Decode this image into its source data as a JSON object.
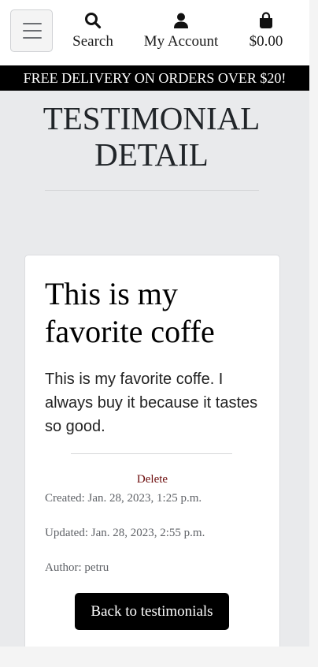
{
  "nav": {
    "menu_icon": "hamburger-icon",
    "search": {
      "label": "Search",
      "icon": "search-icon"
    },
    "account": {
      "label": "My Account",
      "icon": "user-icon"
    },
    "cart": {
      "label": "$0.00",
      "icon": "shopping-bag-icon"
    }
  },
  "banner": {
    "text": "FREE DELIVERY ON ORDERS OVER $20!"
  },
  "page": {
    "title_line1": "TESTIMONIAL",
    "title_line2": "DETAIL"
  },
  "testimonial": {
    "title": "This is my favorite coffe",
    "body": "This is my favorite coffe. I always buy it because it tastes so good.",
    "delete_label": "Delete",
    "created": "Created: Jan. 28, 2023, 1:25 p.m.",
    "updated": "Updated: Jan. 28, 2023, 2:55 p.m.",
    "author": "Author: petru",
    "back_label": "Back to testimonials"
  },
  "colors": {
    "banner_bg": "#000000",
    "delete_link": "#6b0a0a",
    "button_bg": "#000000",
    "page_bg": "#e9eaec"
  }
}
